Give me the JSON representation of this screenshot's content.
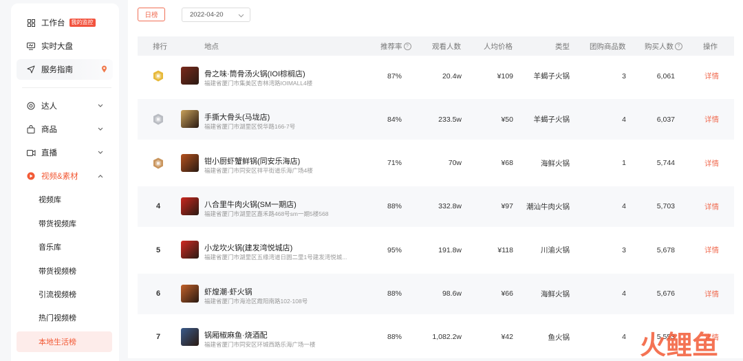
{
  "sidebar": {
    "workbench": "工作台",
    "workbench_badge": "我的监控",
    "dashboard": "实时大盘",
    "guide": "服务指南",
    "talent": "达人",
    "goods": "商品",
    "live": "直播",
    "video_material": "视频&素材",
    "sub_items": [
      "视频库",
      "带货视频库",
      "音乐库",
      "带货视频榜",
      "引流视频榜",
      "热门视频榜",
      "本地生活榜"
    ]
  },
  "toolbar": {
    "daily_label": "日榜",
    "date_value": "2022-04-20"
  },
  "table": {
    "headers": {
      "rank": "排行",
      "place": "地点",
      "recommend": "推荐率",
      "viewers": "观看人数",
      "avg_price": "人均价格",
      "category": "类型",
      "group_items": "团购商品数",
      "buyers": "购买人数",
      "action": "操作"
    },
    "rows": [
      {
        "rank": "",
        "medal": "gold",
        "name": "骨之味·筒骨汤火锅(IOI棕榈店)",
        "address": "福建省厦门市集美区杏林湾路IOIMALL4楼",
        "recommend": "87%",
        "viewers": "20.4w",
        "price": "¥109",
        "category": "羊蝎子火锅",
        "items": "3",
        "buyers": "6,061",
        "action": "详情",
        "thumb_color": "#7a2a1c"
      },
      {
        "rank": "",
        "medal": "silver",
        "name": "手撕大骨头(马垅店)",
        "address": "福建省厦门市湖里区悦华路166-7号",
        "recommend": "84%",
        "viewers": "233.5w",
        "price": "¥50",
        "category": "羊蝎子火锅",
        "items": "4",
        "buyers": "6,037",
        "action": "详情",
        "thumb_color": "#c8a15a"
      },
      {
        "rank": "",
        "medal": "bronze",
        "name": "钳小厨虾蟹鲜锅(同安乐海店)",
        "address": "福建省厦门市同安区祥平街道乐海广场4楼",
        "recommend": "71%",
        "viewers": "70w",
        "price": "¥68",
        "category": "海鲜火锅",
        "items": "1",
        "buyers": "5,744",
        "action": "详情",
        "thumb_color": "#b5521e"
      },
      {
        "rank": "4",
        "medal": "",
        "name": "八合里牛肉火锅(SM一期店)",
        "address": "福建省厦门市湖里区嘉禾路468号sm一期5楼568",
        "recommend": "88%",
        "viewers": "332.8w",
        "price": "¥97",
        "category": "潮汕牛肉火锅",
        "items": "4",
        "buyers": "5,703",
        "action": "详情",
        "thumb_color": "#c9271f"
      },
      {
        "rank": "5",
        "medal": "",
        "name": "小龙坎火锅(建发湾悦城店)",
        "address": "福建省厦门市湖里区五缘湾道日圆二里1号建发湾悦城...",
        "recommend": "95%",
        "viewers": "191.8w",
        "price": "¥118",
        "category": "川渝火锅",
        "items": "3",
        "buyers": "5,678",
        "action": "详情",
        "thumb_color": "#d12a24"
      },
      {
        "rank": "6",
        "medal": "",
        "name": "虾煌潮·虾火锅",
        "address": "福建省厦门市海沧区霞阳南路102-108号",
        "recommend": "88%",
        "viewers": "98.6w",
        "price": "¥66",
        "category": "海鲜火锅",
        "items": "4",
        "buyers": "5,676",
        "action": "详情",
        "thumb_color": "#c2612a"
      },
      {
        "rank": "7",
        "medal": "",
        "name": "锅厢椒麻鱼·烧酒配",
        "address": "福建省厦门市同安区环城西路乐海广场一楼",
        "recommend": "88%",
        "viewers": "1,082.2w",
        "price": "¥42",
        "category": "鱼火锅",
        "items": "4",
        "buyers": "5,553",
        "action": "详情",
        "thumb_color": "#3a5a8a"
      }
    ]
  },
  "watermark_text": "火鲤鱼",
  "colors": {
    "accent": "#f06f55",
    "gold": "#e7b93a",
    "silver": "#b9bcc2",
    "bronze": "#c9955d"
  }
}
